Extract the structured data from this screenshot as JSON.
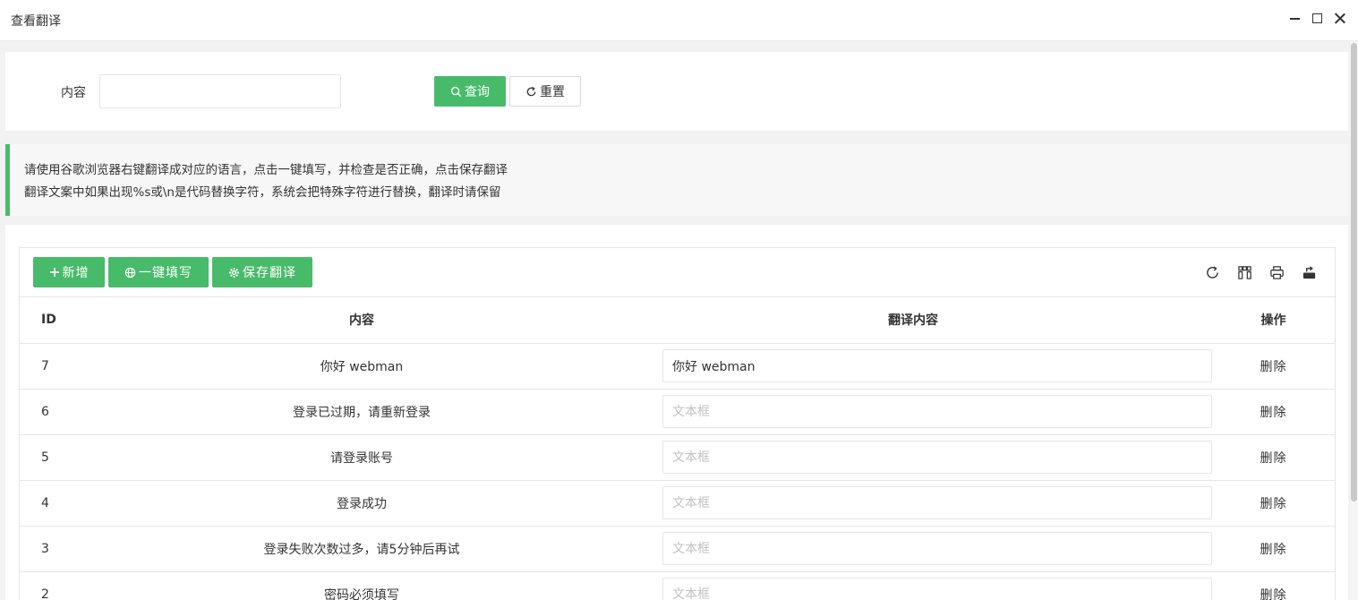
{
  "window": {
    "title": "查看翻译",
    "minimize_icon": "minimize-icon",
    "maximize_icon": "maximize-icon",
    "close_icon": "close-icon"
  },
  "search": {
    "label": "内容",
    "value": "",
    "placeholder": "",
    "query_label": "查询",
    "reset_label": "重置"
  },
  "tip": {
    "line1": "请使用谷歌浏览器右键翻译成对应的语言，点击一键填写，并检查是否正确，点击保存翻译",
    "line2": "翻译文案中如果出现%s或\\n是代码替换字符，系统会把特殊字符进行替换，翻译时请保留"
  },
  "toolbar": {
    "add_label": "新增",
    "autofill_label": "一键填写",
    "save_label": "保存翻译",
    "icons": [
      "refresh-icon",
      "columns-icon",
      "print-icon",
      "export-icon"
    ]
  },
  "table": {
    "headers": {
      "id": "ID",
      "content": "内容",
      "translation": "翻译内容",
      "action": "操作"
    },
    "placeholder": "文本框",
    "delete_label": "删除",
    "rows": [
      {
        "id": "7",
        "content": "你好 webman",
        "translation": "你好 webman"
      },
      {
        "id": "6",
        "content": "登录已过期，请重新登录",
        "translation": ""
      },
      {
        "id": "5",
        "content": "请登录账号",
        "translation": ""
      },
      {
        "id": "4",
        "content": "登录成功",
        "translation": ""
      },
      {
        "id": "3",
        "content": "登录失败次数过多，请5分钟后再试",
        "translation": ""
      },
      {
        "id": "2",
        "content": "密码必须填写",
        "translation": ""
      }
    ]
  },
  "colors": {
    "accent": "#48bb6a",
    "border": "#e6e6e6",
    "background": "#f2f2f2"
  }
}
